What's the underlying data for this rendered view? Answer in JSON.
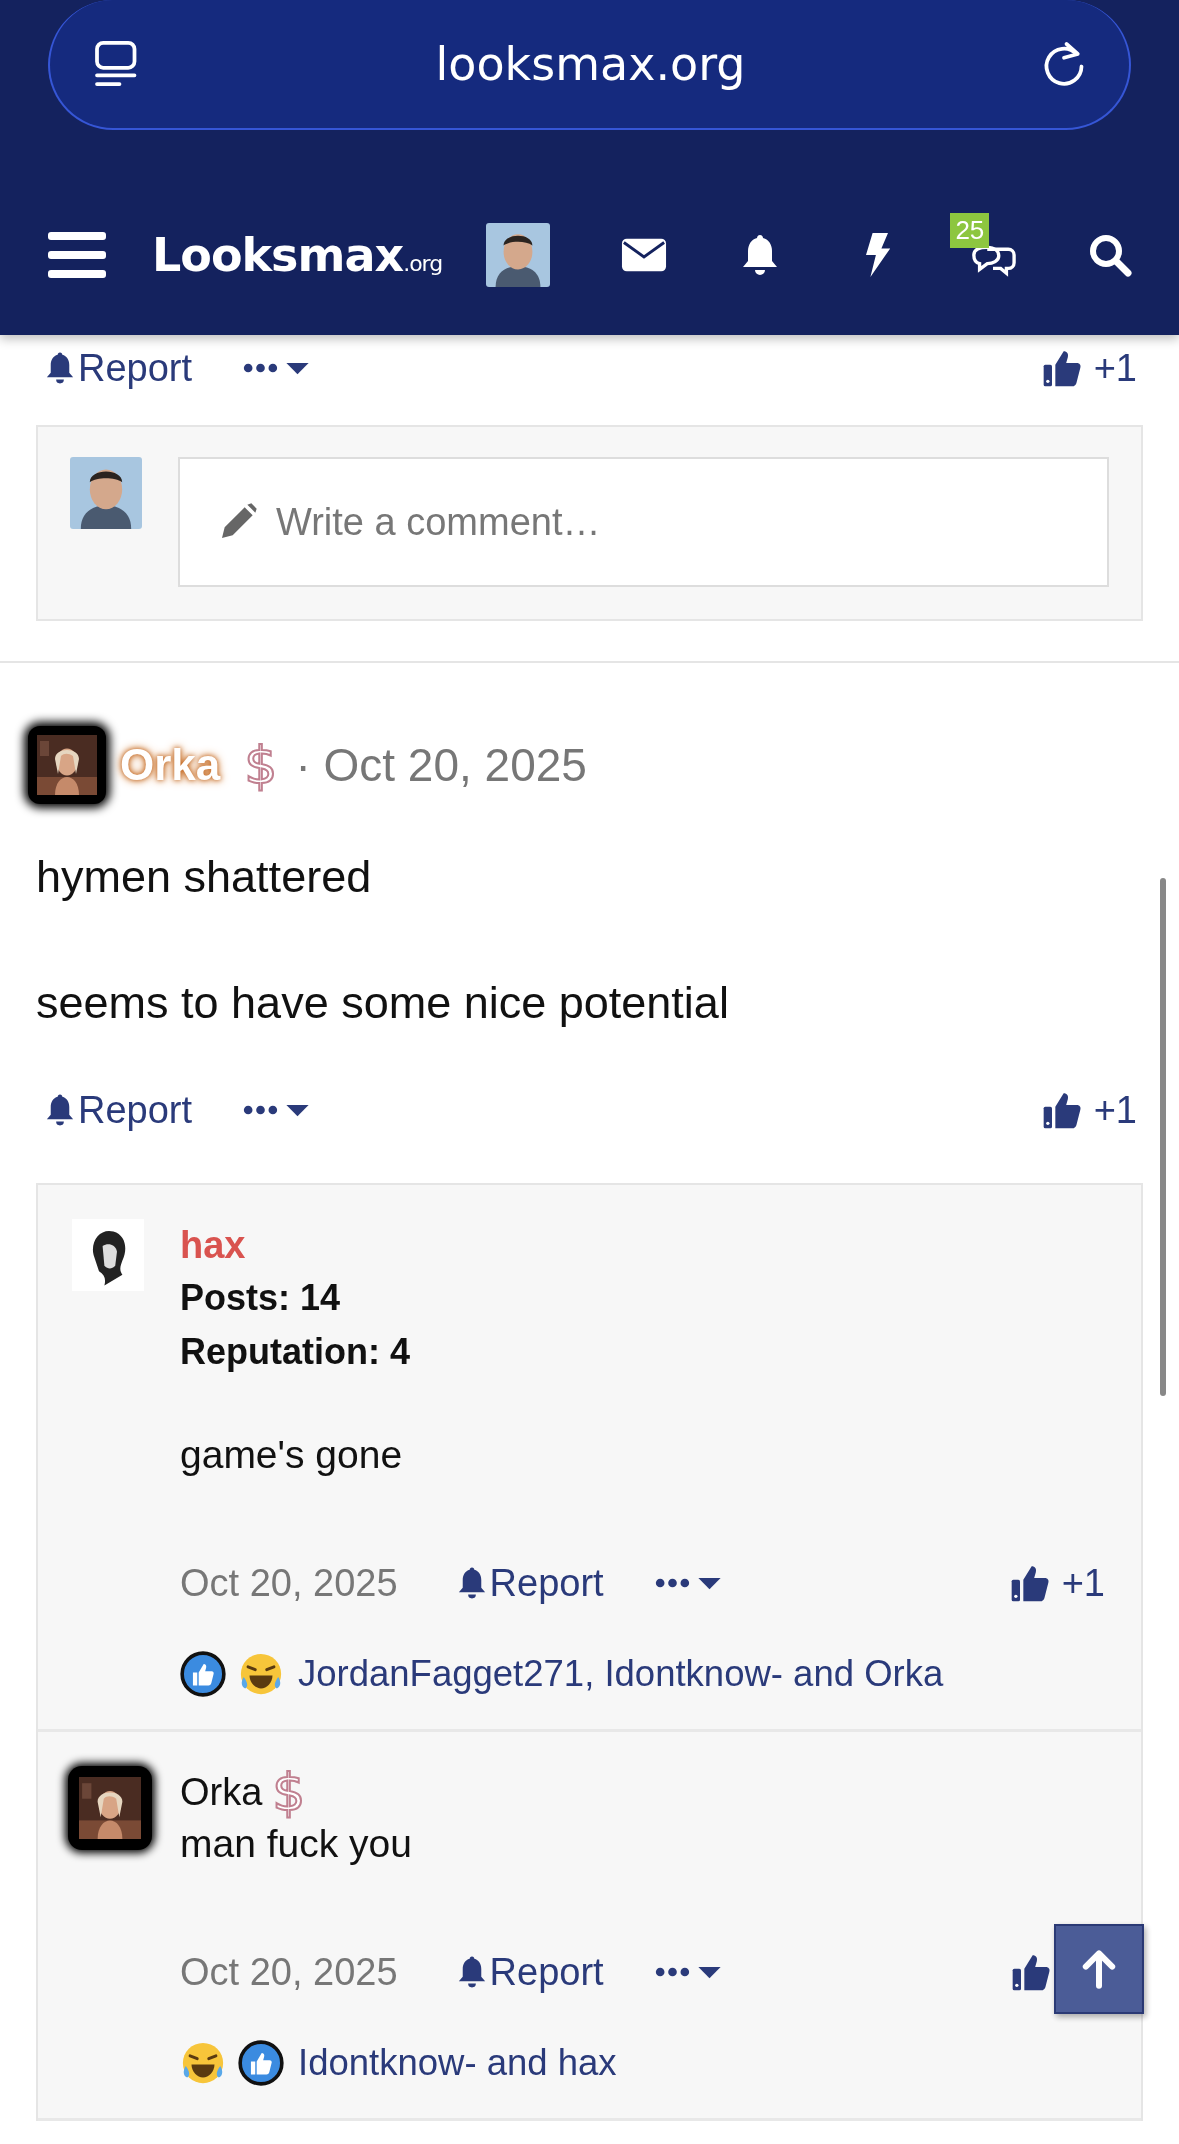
{
  "browser": {
    "url": "looksmax.org"
  },
  "nav": {
    "logo": "Looksmax",
    "logo_suffix": ".org",
    "alerts_badge": "25"
  },
  "prev_post_actions": {
    "report": "Report",
    "likes": "+1"
  },
  "comment_box": {
    "placeholder": "Write a comment…"
  },
  "post": {
    "author": "Orka",
    "badge": "$",
    "date": "· Oct 20, 2025",
    "body": [
      "hymen shattered",
      "seems to have some nice potential"
    ],
    "report": "Report",
    "likes": "+1"
  },
  "replies": [
    {
      "author": "hax",
      "color": "#d9534f",
      "posts": "Posts: 14",
      "reputation": "Reputation: 4",
      "body": "game's gone",
      "date": "Oct 20, 2025",
      "report": "Report",
      "likes": "+1",
      "reactions": [
        {
          "kind": "like"
        },
        {
          "kind": "laugh"
        }
      ],
      "reactors": "JordanFagget271, Idontknow- and Orka"
    },
    {
      "author": "Orka",
      "color": "#111111",
      "badge": "$",
      "body": "man fuck you",
      "date": "Oct 20, 2025",
      "report": "Report",
      "reactions": [
        {
          "kind": "laugh"
        },
        {
          "kind": "like"
        }
      ],
      "reactors": "Idontknow- and hax"
    }
  ]
}
